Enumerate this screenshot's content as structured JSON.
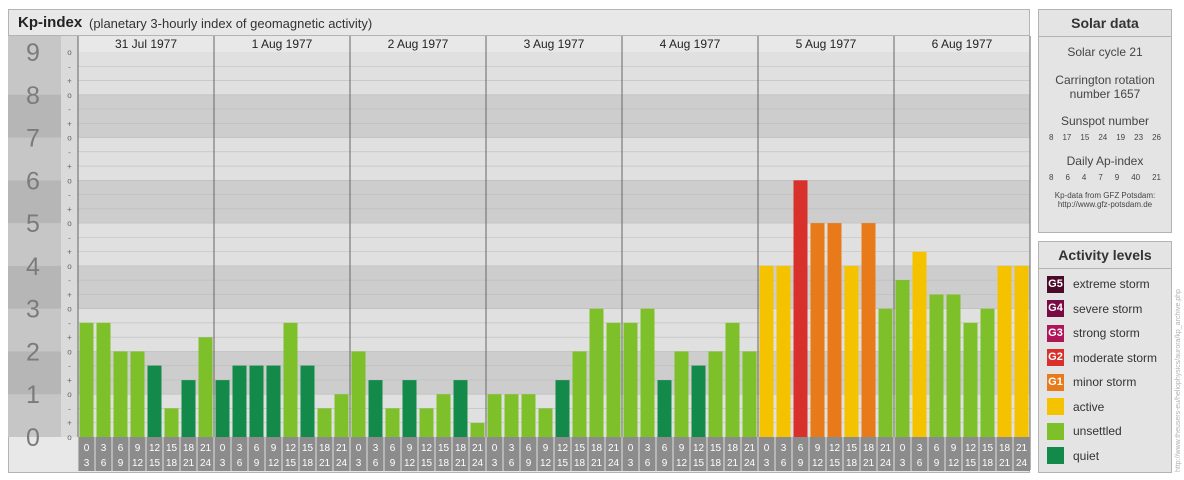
{
  "title": {
    "main": "Kp-index",
    "sub": "(planetary 3-hourly index of geomagnetic activity)"
  },
  "chart_data": {
    "type": "bar",
    "ylim": [
      0,
      9
    ],
    "y_ticks": [
      "0",
      "1",
      "2",
      "3",
      "4",
      "5",
      "6",
      "7",
      "8",
      "9"
    ],
    "thirds_labels": [
      "-",
      "o",
      "+"
    ],
    "days": [
      "31 Jul 1977",
      "1 Aug 1977",
      "2 Aug 1977",
      "3 Aug 1977",
      "4 Aug 1977",
      "5 Aug 1977",
      "6 Aug 1977"
    ],
    "hour_starts": [
      "0",
      "3",
      "6",
      "9",
      "12",
      "15",
      "18",
      "21"
    ],
    "hour_ends": [
      "3",
      "6",
      "9",
      "12",
      "15",
      "18",
      "21",
      "24"
    ],
    "values": [
      [
        2.67,
        2.67,
        2.0,
        2.0,
        1.67,
        0.67,
        1.33,
        2.33
      ],
      [
        1.33,
        1.67,
        1.67,
        1.67,
        2.67,
        1.67,
        0.67,
        1.0
      ],
      [
        2.0,
        1.33,
        0.67,
        1.33,
        0.67,
        1.0,
        1.33,
        0.33
      ],
      [
        1.0,
        1.0,
        1.0,
        0.67,
        1.33,
        2.0,
        3.0,
        2.67
      ],
      [
        2.67,
        3.0,
        1.33,
        2.0,
        1.67,
        2.0,
        2.67,
        2.0
      ],
      [
        4.0,
        4.0,
        6.0,
        5.0,
        5.0,
        4.0,
        5.0,
        3.0
      ],
      [
        3.67,
        4.33,
        3.33,
        3.33,
        2.67,
        3.0,
        4.0,
        4.0
      ]
    ]
  },
  "solar_data": {
    "heading": "Solar data",
    "solar_cycle": "Solar cycle 21",
    "carrington_line1": "Carrington rotation",
    "carrington_line2": "number 1657",
    "sunspot_label": "Sunspot number",
    "sunspot_values": [
      "8",
      "17",
      "15",
      "24",
      "19",
      "23",
      "26"
    ],
    "ap_label": "Daily Ap-index",
    "ap_values": [
      "8",
      "6",
      "4",
      "7",
      "9",
      "40",
      "21"
    ],
    "source_line1": "Kp-data from GFZ Potsdam:",
    "source_line2": "http://www.gfz-potsdam.de"
  },
  "activity_levels": {
    "heading": "Activity levels",
    "items": [
      {
        "code": "G5",
        "label": "extreme storm",
        "color": "#4a0a2a"
      },
      {
        "code": "G4",
        "label": "severe storm",
        "color": "#7a0a44"
      },
      {
        "code": "G3",
        "label": "strong storm",
        "color": "#b01657"
      },
      {
        "code": "G2",
        "label": "moderate storm",
        "color": "#d8302a"
      },
      {
        "code": "G1",
        "label": "minor storm",
        "color": "#e87a1a"
      },
      {
        "code": "",
        "label": "active",
        "color": "#f5c200"
      },
      {
        "code": "",
        "label": "unsettled",
        "color": "#7ec02a"
      },
      {
        "code": "",
        "label": "quiet",
        "color": "#138a4a"
      }
    ]
  },
  "copyright": "http://www.theusers-eu/heliophysics/aurora/kp_archive.php",
  "colors": {
    "quiet": "#138a4a",
    "unsettled": "#7ec02a",
    "active": "#f5c200",
    "g1": "#e87a1a",
    "g2": "#d8302a",
    "g3": "#b01657",
    "g4": "#7a0a44",
    "g5": "#4a0a2a"
  }
}
